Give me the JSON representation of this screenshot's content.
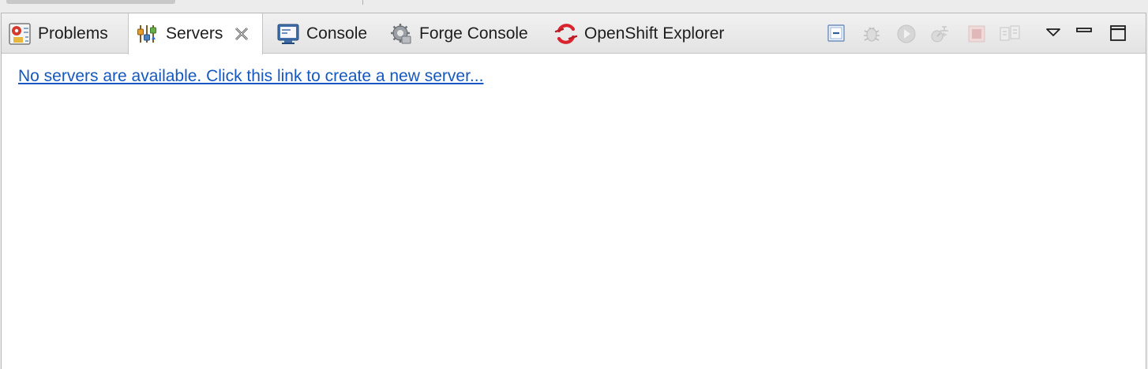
{
  "tabs": [
    {
      "id": "problems",
      "label": "Problems",
      "icon": "problems-icon",
      "active": false
    },
    {
      "id": "servers",
      "label": "Servers",
      "icon": "servers-icon",
      "active": true,
      "closable": true
    },
    {
      "id": "console",
      "label": "Console",
      "icon": "console-icon",
      "active": false
    },
    {
      "id": "forge-console",
      "label": "Forge Console",
      "icon": "forge-icon",
      "active": false
    },
    {
      "id": "openshift-explorer",
      "label": "OpenShift Explorer",
      "icon": "openshift-icon",
      "active": false
    }
  ],
  "toolbar": {
    "buttons": [
      {
        "name": "collapse-all-icon",
        "enabled": true
      },
      {
        "name": "debug-server-icon",
        "enabled": false
      },
      {
        "name": "start-server-icon",
        "enabled": false
      },
      {
        "name": "profile-server-icon",
        "enabled": false
      },
      {
        "name": "stop-server-icon",
        "enabled": false
      },
      {
        "name": "publish-icon",
        "enabled": false
      }
    ],
    "view_menu": "view-menu-icon",
    "minimize": "minimize-icon",
    "maximize": "maximize-icon"
  },
  "content": {
    "create_link": "No servers are available. Click this link to create a new server..."
  },
  "colors": {
    "link": "#1558c0",
    "tab_bar": "#e8e8e8",
    "openshift_red": "#d9232e"
  }
}
